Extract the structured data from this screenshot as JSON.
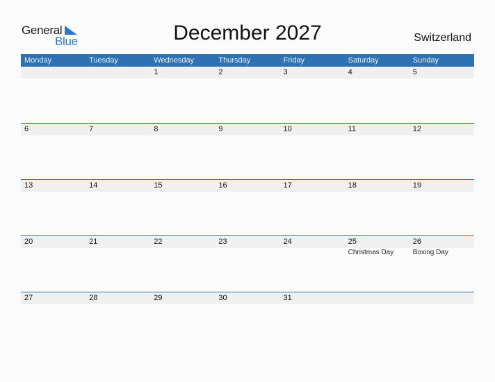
{
  "logo": {
    "general": "General",
    "blue": "Blue",
    "accent_color": "#2a78c9"
  },
  "title": "December 2027",
  "country": "Switzerland",
  "header_color": "#2f72b3",
  "weekdays": [
    "Monday",
    "Tuesday",
    "Wednesday",
    "Thursday",
    "Friday",
    "Saturday",
    "Sunday"
  ],
  "weeks": [
    {
      "days": [
        "",
        "",
        "1",
        "2",
        "3",
        "4",
        "5"
      ],
      "events": [
        "",
        "",
        "",
        "",
        "",
        "",
        ""
      ]
    },
    {
      "days": [
        "6",
        "7",
        "8",
        "9",
        "10",
        "11",
        "12"
      ],
      "events": [
        "",
        "",
        "",
        "",
        "",
        "",
        ""
      ]
    },
    {
      "days": [
        "13",
        "14",
        "15",
        "16",
        "17",
        "18",
        "19"
      ],
      "events": [
        "",
        "",
        "",
        "",
        "",
        "",
        ""
      ]
    },
    {
      "days": [
        "20",
        "21",
        "22",
        "23",
        "24",
        "25",
        "26"
      ],
      "events": [
        "",
        "",
        "",
        "",
        "",
        "Christmas Day",
        "Boxing Day"
      ]
    },
    {
      "days": [
        "27",
        "28",
        "29",
        "30",
        "31",
        "",
        ""
      ],
      "events": [
        "",
        "",
        "",
        "",
        "",
        "",
        ""
      ]
    }
  ]
}
